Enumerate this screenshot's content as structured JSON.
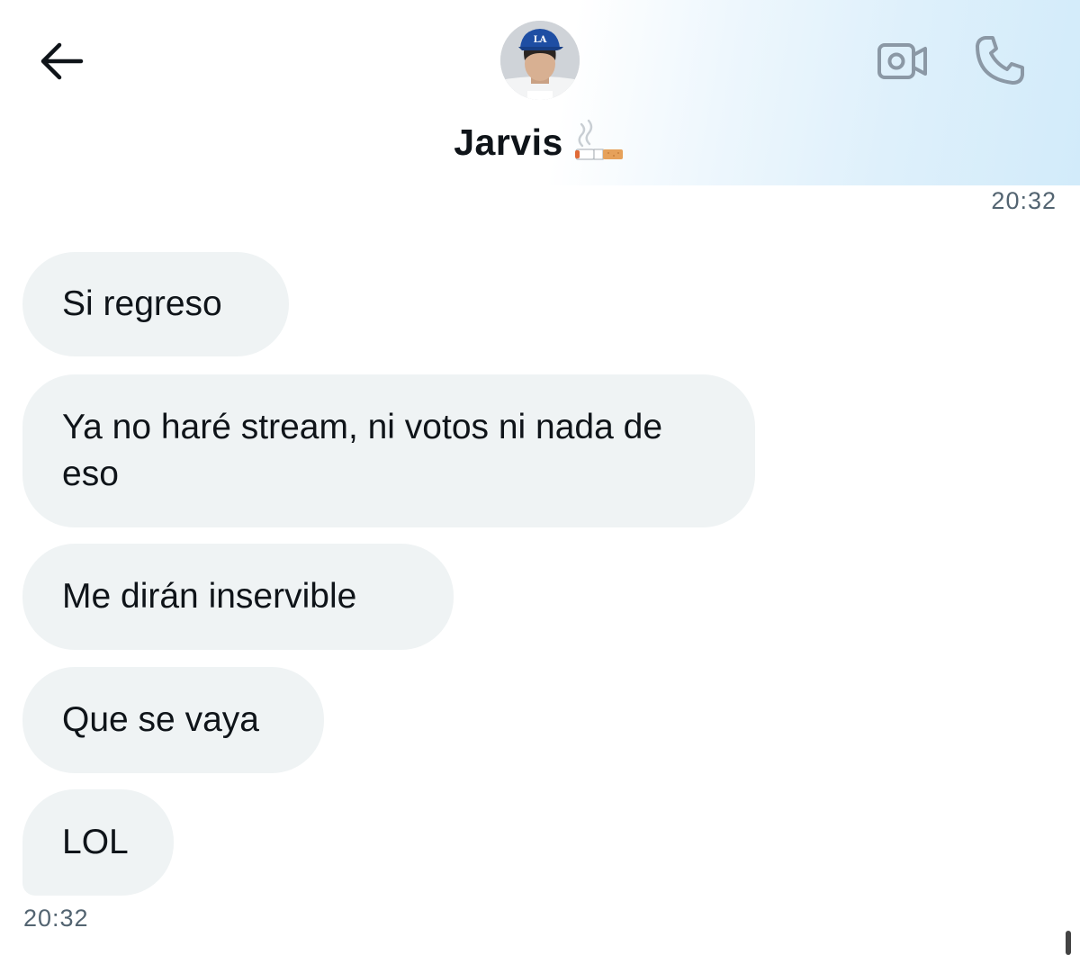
{
  "header": {
    "contact_name": "Jarvis",
    "name_emoji": "cigarette-emoji",
    "back_icon": "arrow-left-icon",
    "video_icon": "video-camera-icon",
    "phone_icon": "phone-icon",
    "gradient_color": "#d2ebfa"
  },
  "conversation": {
    "timestamp_top": "20:32",
    "messages": [
      {
        "text": "Si regreso"
      },
      {
        "text": "Ya no haré stream, ni votos ni nada de eso"
      },
      {
        "text": "Me dirán inservible"
      },
      {
        "text": "Que se vaya"
      },
      {
        "text": "LOL"
      }
    ],
    "timestamp_bottom": "20:32"
  },
  "colors": {
    "bubble_bg": "#eff3f4",
    "text": "#0f1419",
    "muted": "#536471",
    "icon": "#8b98a5"
  }
}
